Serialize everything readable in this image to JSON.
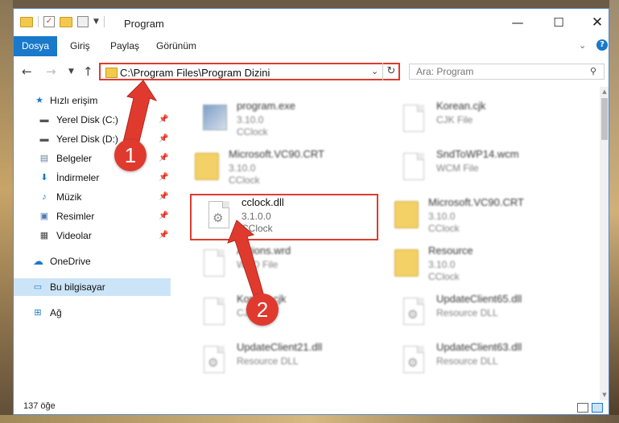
{
  "window": {
    "title": "Program",
    "minimize_glyph": "—",
    "maximize_glyph": "☐",
    "close_glyph": "✕"
  },
  "ribbon": {
    "tabs": [
      "Dosya",
      "Giriş",
      "Paylaş",
      "Görünüm"
    ],
    "accent_color": "#1979ca"
  },
  "address_bar": {
    "path": "C:\\Program Files\\Program Dizini",
    "highlight_color": "#e03a2f"
  },
  "search": {
    "placeholder": "Ara: Program"
  },
  "nav_pane": {
    "quick_access": "Hızlı erişim",
    "items": [
      {
        "label": "Yerel Disk (C:)",
        "icon": "drive-icon",
        "pinned": true
      },
      {
        "label": "Yerel Disk (D:)",
        "icon": "drive-icon",
        "pinned": true
      },
      {
        "label": "Belgeler",
        "icon": "documents-icon",
        "pinned": true
      },
      {
        "label": "İndirmeler",
        "icon": "download-icon",
        "pinned": true
      },
      {
        "label": "Müzik",
        "icon": "music-icon",
        "pinned": true
      },
      {
        "label": "Resimler",
        "icon": "pictures-icon",
        "pinned": true
      },
      {
        "label": "Videolar",
        "icon": "videos-icon",
        "pinned": true
      }
    ],
    "onedrive": "OneDrive",
    "this_pc": "Bu bilgisayar",
    "network": "Ağ"
  },
  "files": [
    {
      "name": "program.exe",
      "line2": "3.10.0",
      "line3": "CClock",
      "icon": "exe-icon"
    },
    {
      "name": "Korean.cjk",
      "line2": "CJK File",
      "line3": "",
      "icon": "file-icon"
    },
    {
      "name": "Microsoft.VC90.CRT",
      "line2": "3.10.0",
      "line3": "CClock",
      "icon": "folder-icon"
    },
    {
      "name": "SndToWP14.wcm",
      "line2": "WCM File",
      "line3": "",
      "icon": "file-icon"
    },
    {
      "name": "cclock.dll",
      "line2": "3.1.0.0",
      "line3": "CClock",
      "icon": "dll-icon"
    },
    {
      "name": "Microsoft.VC90.CRT",
      "line2": "3.10.0",
      "line3": "CClock",
      "icon": "folder-icon"
    },
    {
      "name": "Actions.wrd",
      "line2": "WRD File",
      "line3": "",
      "icon": "file-icon"
    },
    {
      "name": "Resource",
      "line2": "3.10.0",
      "line3": "CClock",
      "icon": "folder-icon"
    },
    {
      "name": "Korean.cjk",
      "line2": "CJK File",
      "line3": "",
      "icon": "file-icon"
    },
    {
      "name": "UpdateClient65.dll",
      "line2": "Resource DLL",
      "line3": "",
      "icon": "dll-icon"
    },
    {
      "name": "UpdateClient21.dll",
      "line2": "Resource DLL",
      "line3": "",
      "icon": "dll-icon"
    },
    {
      "name": "UpdateClient63.dll",
      "line2": "Resource DLL",
      "line3": "",
      "icon": "dll-icon"
    }
  ],
  "status_bar": {
    "item_count": "137 öğe"
  },
  "annotations": {
    "step1": "1",
    "step2": "2",
    "color": "#e03a2f"
  }
}
